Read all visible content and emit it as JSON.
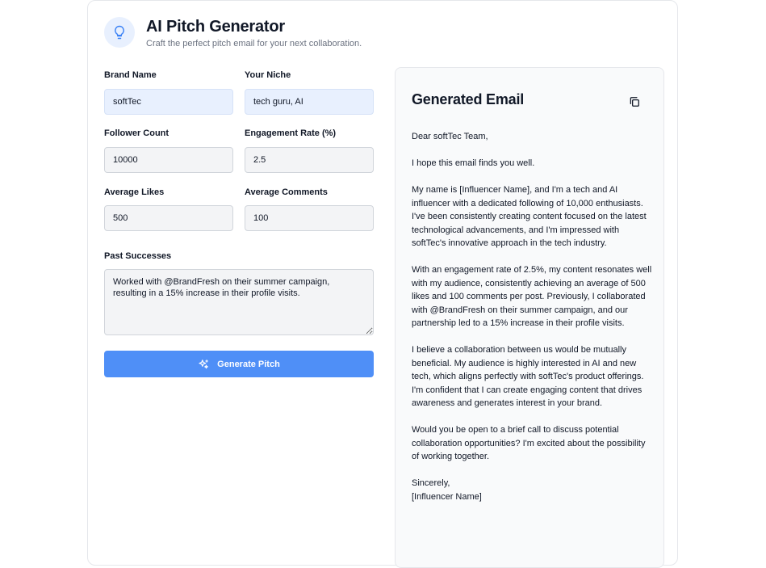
{
  "header": {
    "title": "AI Pitch Generator",
    "subtitle": "Craft the perfect pitch email for your next collaboration.",
    "icon": "lightbulb-icon"
  },
  "form": {
    "brand_name": {
      "label": "Brand Name",
      "value": "softTec"
    },
    "niche": {
      "label": "Your Niche",
      "value": "tech guru, AI"
    },
    "follower_count": {
      "label": "Follower Count",
      "value": "10000"
    },
    "engagement_rate": {
      "label": "Engagement Rate (%)",
      "value": "2.5"
    },
    "average_likes": {
      "label": "Average Likes",
      "value": "500"
    },
    "average_comments": {
      "label": "Average Comments",
      "value": "100"
    },
    "past_successes": {
      "label": "Past Successes",
      "value": "Worked with @BrandFresh on their summer campaign, resulting in a 15% increase in their profile visits."
    },
    "generate_button": {
      "label": "Generate Pitch",
      "icon": "sparkles-icon"
    }
  },
  "email": {
    "title": "Generated Email",
    "copy_icon": "copy-icon",
    "paragraphs": [
      "Dear softTec Team,",
      "I hope this email finds you well.",
      "My name is [Influencer Name], and I'm a tech and AI influencer with a dedicated following of 10,000 enthusiasts. I've been consistently creating content focused on the latest technological advancements, and I'm impressed with softTec's innovative approach in the tech industry.",
      "With an engagement rate of 2.5%, my content resonates well with my audience, consistently achieving an average of 500 likes and 100 comments per post. Previously, I collaborated with @BrandFresh on their summer campaign, and our partnership led to a 15% increase in their profile visits.",
      "I believe a collaboration between us would be mutually beneficial. My audience is highly interested in AI and new tech, which aligns perfectly with softTec's product offerings. I'm confident that I can create engaging content that drives awareness and generates interest in your brand.",
      "Would you be open to a brief call to discuss potential collaboration opportunities? I'm excited about the possibility of working together."
    ],
    "closing": "Sincerely,",
    "signature": "[Influencer Name]"
  },
  "colors": {
    "accent": "#4f8ff7",
    "filled_input": "#e8f0fe",
    "input_bg": "#f3f4f6",
    "panel_bg": "#f9fafb"
  }
}
